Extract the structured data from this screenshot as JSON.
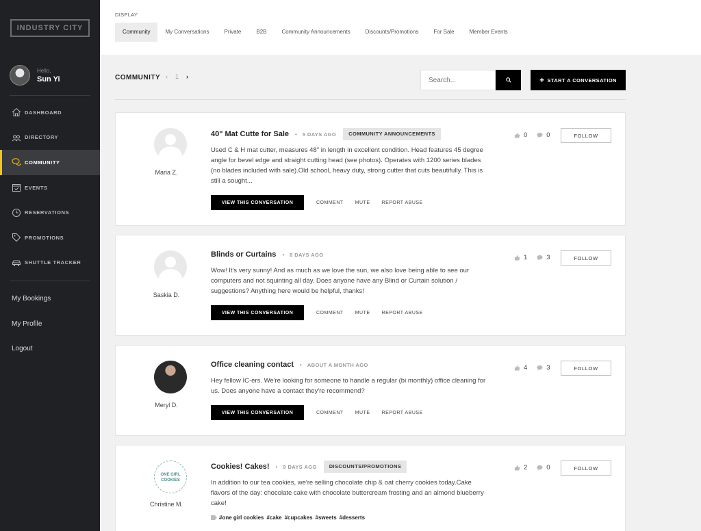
{
  "sidebar": {
    "logo": "INDUSTRY CITY",
    "greeting": "Hello,",
    "user_name": "Sun Yi",
    "nav": [
      {
        "label": "DASHBOARD",
        "icon": "home-icon"
      },
      {
        "label": "DIRECTORY",
        "icon": "people-icon"
      },
      {
        "label": "COMMUNITY",
        "icon": "chat-icon",
        "active": true
      },
      {
        "label": "EVENTS",
        "icon": "calendar-icon"
      },
      {
        "label": "RESERVATIONS",
        "icon": "clock-icon"
      },
      {
        "label": "PROMOTIONS",
        "icon": "tag-icon"
      },
      {
        "label": "SHUTTLE TRACKER",
        "icon": "car-icon"
      }
    ],
    "links": [
      "My Bookings",
      "My Profile",
      "Logout"
    ],
    "accent": "#f5c518"
  },
  "display": {
    "label": "DISPLAY",
    "tabs": [
      "Community",
      "My Conversations",
      "Private",
      "B2B",
      "Community Announcements",
      "Discounts/Promotions",
      "For Sale",
      "Member Events"
    ],
    "active_tab": "Community"
  },
  "header": {
    "title": "COMMUNITY",
    "prev": "‹",
    "page": "1",
    "next": "›",
    "search_placeholder": "Search...",
    "start_button": "START A CONVERSATION"
  },
  "posts": [
    {
      "author": "Maria Z.",
      "title": "40\" Mat Cutte for Sale",
      "time": "5 DAYS AGO",
      "badge": "COMMUNITY ANNOUNCEMENTS",
      "body": "Used C & H mat cutter, measures 48\" in length in excellent condition. Head features 45 degree angle for bevel edge and straight cutting head (see photos). Operates with 1200 series blades (no blades included with sale).Old school, heavy duty, strong cutter that cuts beautifully. This is still a sought...",
      "likes": "0",
      "comments": "0"
    },
    {
      "author": "Saskia D.",
      "title": "Blinds or Curtains",
      "time": "8 DAYS AGO",
      "badge": "",
      "body": "Wow! It's very sunny! And as much as we love the sun, we also love being able to see our computers and not squinting all day. Does anyone have any Blind or Curtain solution / suggestions? Anything here would be helpful, thanks!",
      "likes": "1",
      "comments": "3"
    },
    {
      "author": "Meryl D.",
      "title": "Office cleaning contact",
      "time": "ABOUT A MONTH AGO",
      "badge": "",
      "body": "Hey fellow IC-ers. We're looking for someone to handle a regular (bi monthly) office cleaning for us. Does anyone have a contact they're recommend?",
      "likes": "4",
      "comments": "3"
    },
    {
      "author": "Christine M.",
      "title": "Cookies! Cakes!",
      "time": "9 DAYS AGO",
      "badge": "DISCOUNTS/PROMOTIONS",
      "body": "In addition to our tea cookies, we're selling chocolate chip & oat cherry cookies today.Cake flavors of the day: chocolate cake with chocolate buttercream frosting and an almond blueberry cake!",
      "likes": "2",
      "comments": "0",
      "tags": [
        "#one girl cookies",
        "#cake",
        "#cupcakes",
        "#sweets",
        "#desserts"
      ],
      "logo_text": "ONE GIRL COOKIES"
    }
  ],
  "actions": {
    "view": "VIEW THIS CONVERSATION",
    "comment": "COMMENT",
    "mute": "MUTE",
    "report": "REPORT ABUSE",
    "follow": "FOLLOW"
  }
}
